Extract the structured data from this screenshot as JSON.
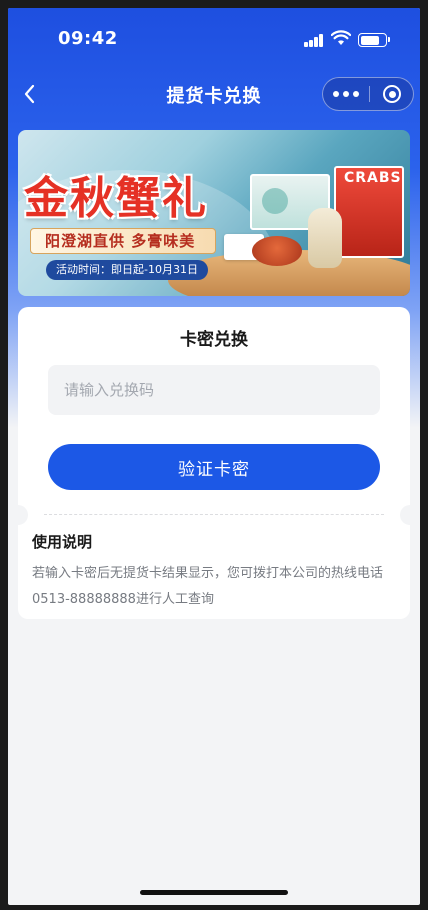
{
  "status_bar": {
    "time": "09:42",
    "battery_level": 0.8
  },
  "nav": {
    "title": "提货卡兑换"
  },
  "banner": {
    "title": "金秋蟹礼",
    "slogan": "阳澄湖直供 多膏味美",
    "date_text": "活动时间：即日起-10月31日",
    "box_text": "CRABS"
  },
  "redeem": {
    "title": "卡密兑换",
    "input_placeholder": "请输入兑换码",
    "input_value": "",
    "verify_button": "验证卡密"
  },
  "usage": {
    "title": "使用说明",
    "text": "若输入卡密后无提货卡结果显示，您可拨打本公司的热线电话0513-88888888进行人工查询"
  },
  "colors": {
    "brand_blue": "#1c58e6",
    "nav_blue": "#1e4fe0",
    "banner_red": "#e53125"
  }
}
